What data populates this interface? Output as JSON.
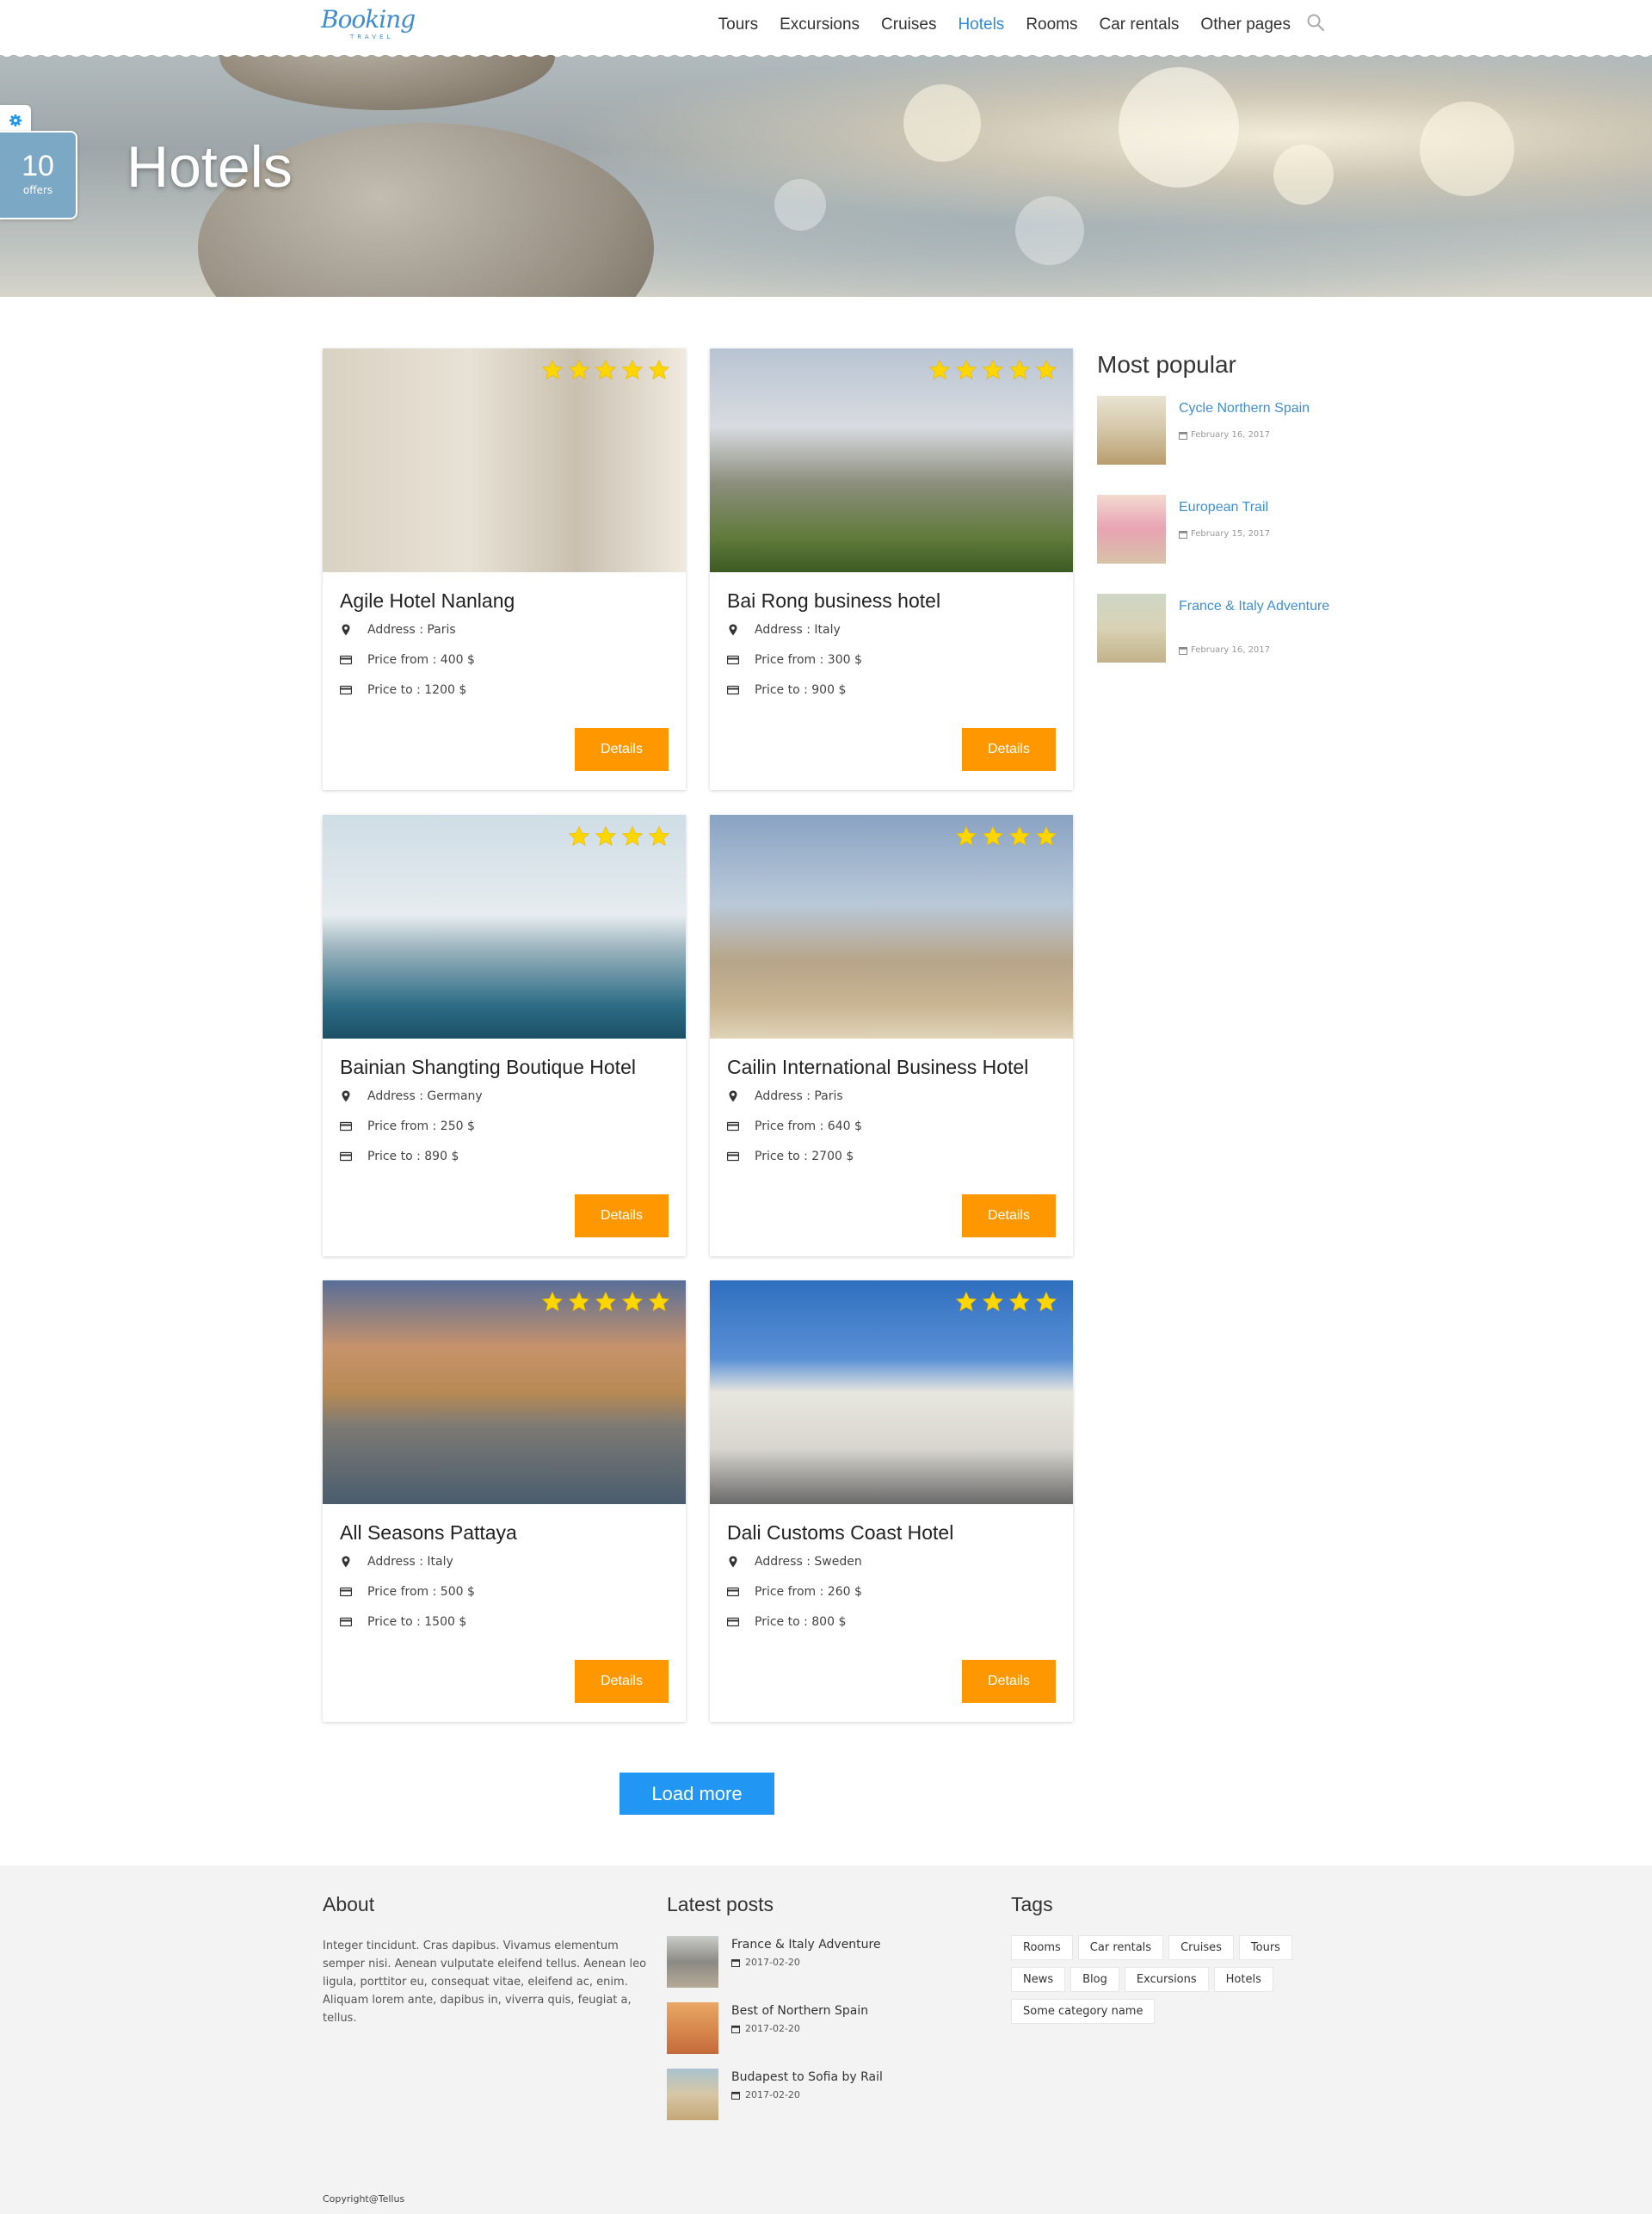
{
  "logo": {
    "script": "Booking",
    "sub": "TRAVEL"
  },
  "nav": {
    "items": [
      "Tours",
      "Excursions",
      "Cruises",
      "Hotels",
      "Rooms",
      "Car rentals",
      "Other pages"
    ],
    "active": "Hotels"
  },
  "hero": {
    "title": "Hotels"
  },
  "offers_badge": {
    "count": "10",
    "label": "offers"
  },
  "labels": {
    "address": "Address : ",
    "price_from": "Price from : ",
    "price_to": "Price to : ",
    "details": "Details"
  },
  "hotels": [
    {
      "name": "Agile Hotel Nanlang",
      "stars": 5,
      "address": "Address : Paris",
      "price_from": "Price from : 400 $",
      "price_to": "Price to : 1200 $",
      "details": "Details"
    },
    {
      "name": "Bai Rong business hotel",
      "stars": 5,
      "address": "Address : Italy",
      "price_from": "Price from : 300 $",
      "price_to": "Price to : 900 $",
      "details": "Details"
    },
    {
      "name": "Bainian Shangting Boutique Hotel",
      "stars": 4,
      "address": "Address : Germany",
      "price_from": "Price from : 250 $",
      "price_to": "Price to : 890 $",
      "details": "Details"
    },
    {
      "name": "Cailin International Business Hotel",
      "stars": 4,
      "address": "Address : Paris",
      "price_from": "Price from : 640 $",
      "price_to": "Price to : 2700 $",
      "details": "Details"
    },
    {
      "name": "All Seasons Pattaya",
      "stars": 5,
      "address": "Address : Italy",
      "price_from": "Price from : 500 $",
      "price_to": "Price to : 1500 $",
      "details": "Details"
    },
    {
      "name": "Dali Customs Coast Hotel",
      "stars": 4,
      "address": "Address : Sweden",
      "price_from": "Price from : 260 $",
      "price_to": "Price to : 800 $",
      "details": "Details"
    }
  ],
  "load_more": "Load more",
  "sidebar": {
    "title": "Most popular",
    "items": [
      {
        "title": "Cycle Northern Spain",
        "date": "February 16, 2017"
      },
      {
        "title": "European Trail",
        "date": "February 15, 2017"
      },
      {
        "title": "France & Italy Adventure",
        "date": "February 16, 2017"
      }
    ]
  },
  "footer": {
    "about_title": "About",
    "about_text": "Integer tincidunt. Cras dapibus. Vivamus elementum semper nisi. Aenean vulputate eleifend tellus. Aenean leo ligula, porttitor eu, consequat vitae, eleifend ac, enim. Aliquam lorem ante, dapibus in, viverra quis, feugiat a, tellus.",
    "posts_title": "Latest posts",
    "posts": [
      {
        "title": "France & Italy Adventure",
        "date": "2017-02-20"
      },
      {
        "title": "Best of Northern Spain",
        "date": "2017-02-20"
      },
      {
        "title": "Budapest to Sofia by Rail",
        "date": "2017-02-20"
      }
    ],
    "tags_title": "Tags",
    "tags": [
      "Rooms",
      "Car rentals",
      "Cruises",
      "Tours",
      "News",
      "Blog",
      "Excursions",
      "Hotels",
      "Some category name"
    ],
    "copyright": "Copyright@Tellus"
  },
  "colors": {
    "accent": "#2f8bd6",
    "button_orange": "#ff9800",
    "load_more_blue": "#2196f3",
    "star_yellow": "#ffd600"
  }
}
